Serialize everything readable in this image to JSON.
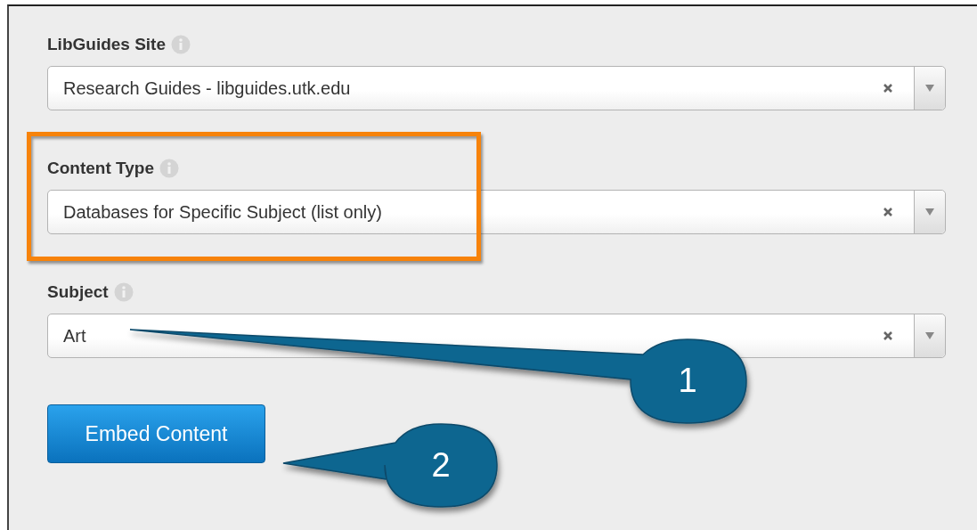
{
  "fields": [
    {
      "label": "LibGuides Site",
      "value": "Research Guides - libguides.utk.edu",
      "highlighted": false
    },
    {
      "label": "Content Type",
      "value": "Databases for Specific Subject (list only)",
      "highlighted": true
    },
    {
      "label": "Subject",
      "value": "Art",
      "highlighted": false
    }
  ],
  "button": {
    "label": "Embed Content"
  },
  "callouts": [
    {
      "number": "1"
    },
    {
      "number": "2"
    }
  ]
}
